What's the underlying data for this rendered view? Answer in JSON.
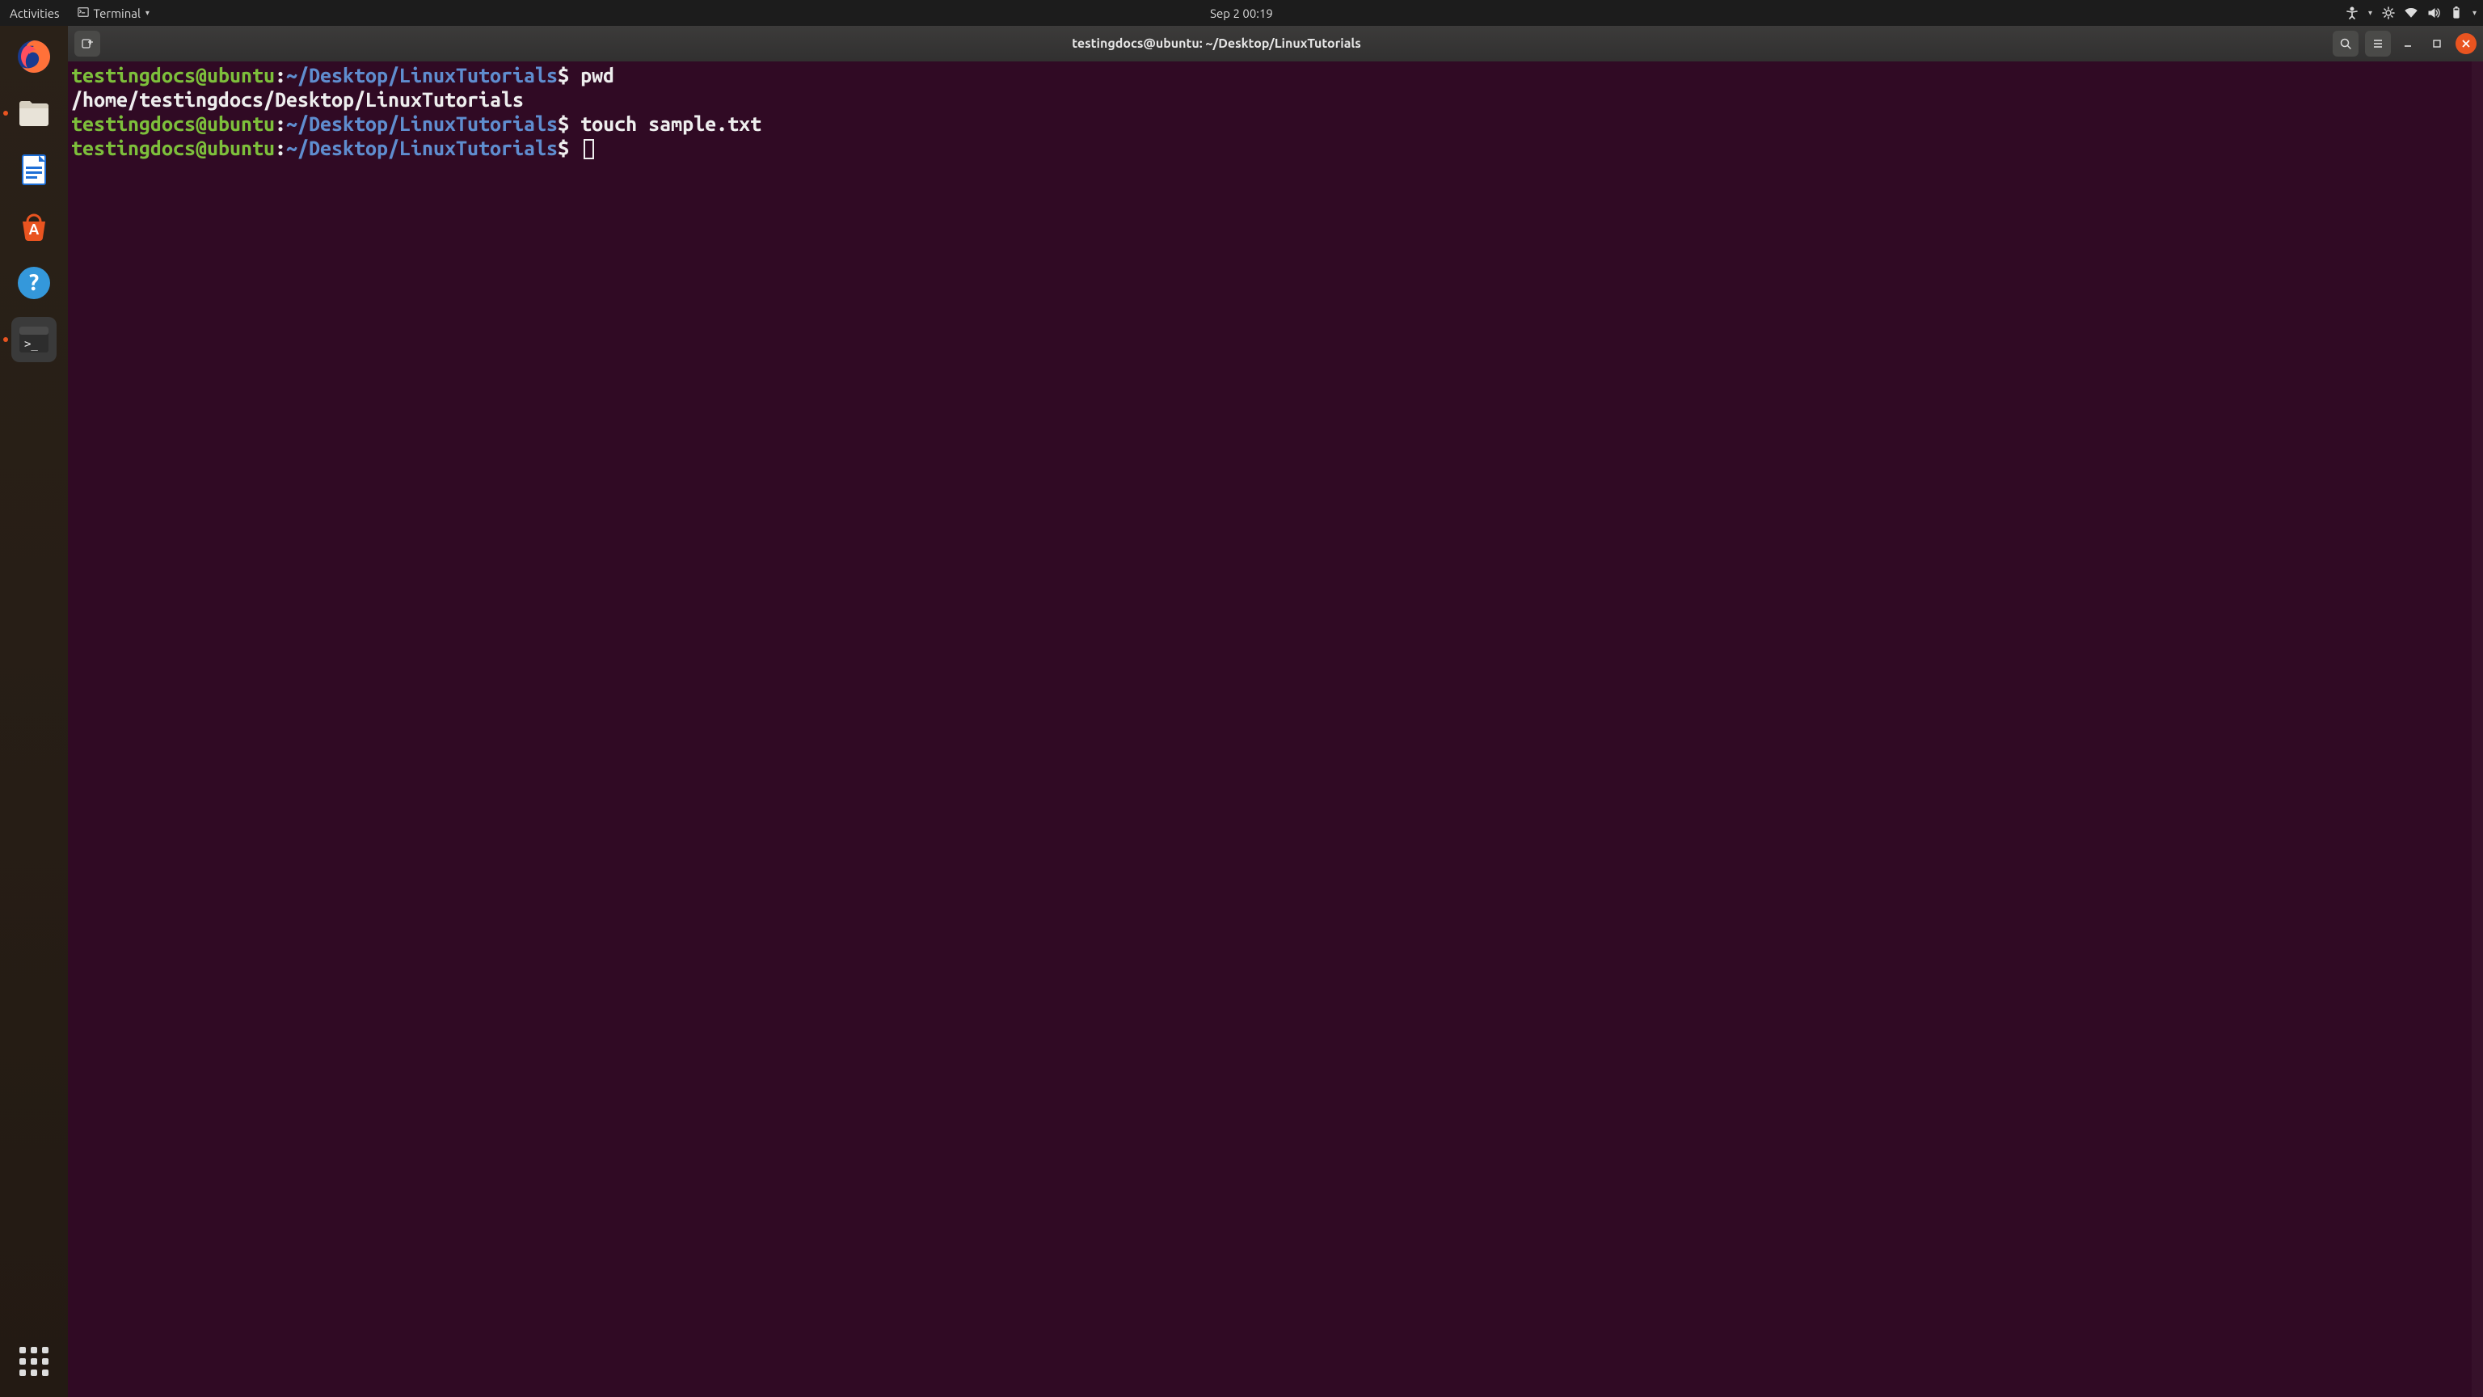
{
  "topbar": {
    "activities": "Activities",
    "app_name": "Terminal",
    "clock": "Sep 2  00:19"
  },
  "dock": {
    "items": [
      {
        "name": "firefox",
        "running": false
      },
      {
        "name": "files",
        "running": true
      },
      {
        "name": "writer",
        "running": false
      },
      {
        "name": "software",
        "running": false
      },
      {
        "name": "help",
        "running": false
      },
      {
        "name": "terminal",
        "running": true
      }
    ]
  },
  "window": {
    "title": "testingdocs@ubuntu: ~/Desktop/LinuxTutorials"
  },
  "terminal": {
    "prompt": {
      "userhost": "testingdocs@ubuntu",
      "sep1": ":",
      "path": "~/Desktop/LinuxTutorials",
      "sep2": "$ "
    },
    "lines": [
      {
        "type": "cmd",
        "text": "pwd"
      },
      {
        "type": "out",
        "text": "/home/testingdocs/Desktop/LinuxTutorials"
      },
      {
        "type": "cmd",
        "text": "touch sample.txt"
      },
      {
        "type": "cmd",
        "text": ""
      }
    ]
  }
}
